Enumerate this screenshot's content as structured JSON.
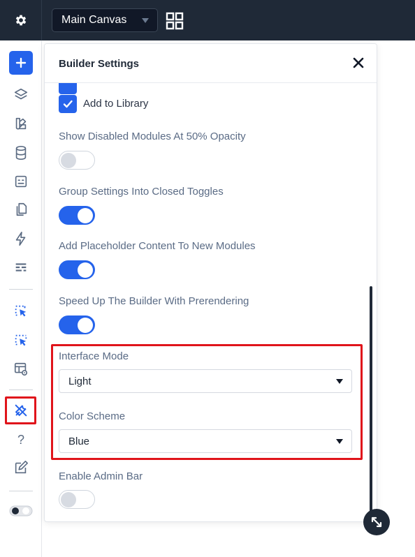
{
  "topbar": {
    "canvas_select_value": "Main Canvas",
    "gear_icon": "gear-icon",
    "grid_icon": "grid-icon"
  },
  "sidebar": {
    "items": [
      {
        "name": "add",
        "icon": "plus-icon"
      },
      {
        "name": "layers",
        "icon": "layers-icon"
      },
      {
        "name": "theme",
        "icon": "brush-icon"
      },
      {
        "name": "database",
        "icon": "database-icon"
      },
      {
        "name": "dynamic",
        "icon": "content-icon"
      },
      {
        "name": "pages",
        "icon": "pages-icon"
      },
      {
        "name": "performance",
        "icon": "bolt-icon"
      },
      {
        "name": "layout",
        "icon": "layout-icon"
      },
      {
        "name": "select-1",
        "icon": "select-cursor-icon"
      },
      {
        "name": "select-2",
        "icon": "select-cursor-icon"
      },
      {
        "name": "preview",
        "icon": "preview-icon"
      },
      {
        "name": "tools",
        "icon": "tools-icon"
      },
      {
        "name": "help",
        "icon": "help-icon",
        "glyph": "?"
      },
      {
        "name": "edit",
        "icon": "edit-icon"
      },
      {
        "name": "mode-toggle",
        "icon": "mode-toggle-icon"
      }
    ]
  },
  "panel": {
    "title": "Builder Settings",
    "checkbox_add_library": "Add to Library",
    "options": {
      "disabled_opacity": {
        "label": "Show Disabled Modules At 50% Opacity",
        "on": false
      },
      "group_toggles": {
        "label": "Group Settings Into Closed Toggles",
        "on": true
      },
      "placeholder": {
        "label": "Add Placeholder Content To New Modules",
        "on": true
      },
      "prerender": {
        "label": "Speed Up The Builder With Prerendering",
        "on": true
      },
      "admin_bar": {
        "label": "Enable Admin Bar",
        "on": false
      }
    },
    "interface_mode": {
      "label": "Interface Mode",
      "value": "Light"
    },
    "color_scheme": {
      "label": "Color Scheme",
      "value": "Blue"
    }
  },
  "colors": {
    "accent": "#2563eb",
    "topbar": "#1f2937",
    "highlight": "#e0141b"
  }
}
